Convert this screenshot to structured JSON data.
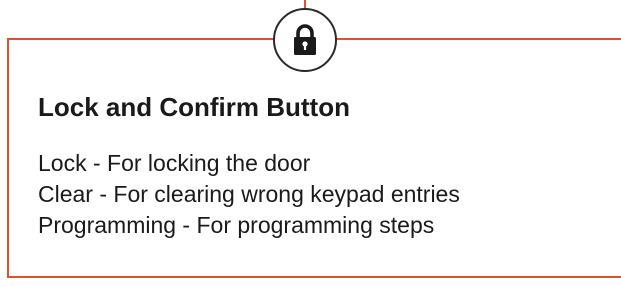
{
  "icon": "lock-icon",
  "colors": {
    "accent": "#e0522d",
    "icon_stroke": "#2a2a2a",
    "text": "#1a1a1a"
  },
  "title": "Lock and Confirm Button",
  "functions": [
    "Lock - For locking the door",
    "Clear - For clearing wrong keypad entries",
    "Programming - For programming steps"
  ]
}
